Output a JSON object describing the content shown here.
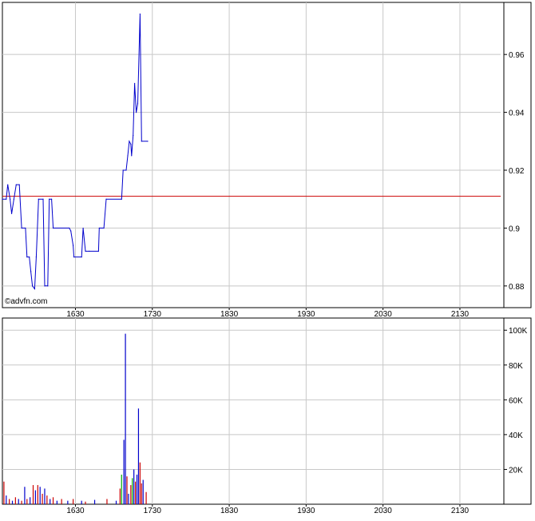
{
  "watermark": "©advfn.com",
  "colors": {
    "price_line": "#0000cc",
    "reference_line": "#cc0000",
    "grid": "#c8c8c8",
    "frame": "#000000",
    "volume_up": "#0000cc",
    "volume_down": "#cc0000",
    "volume_neutral": "#00aa00"
  },
  "chart_data": [
    {
      "type": "line",
      "grid": true,
      "x_ticks": [
        "1630",
        "1730",
        "1830",
        "1930",
        "2030",
        "2130"
      ],
      "x_tick_values": [
        1630,
        1730,
        1830,
        1930,
        2030,
        2130
      ],
      "xlim": [
        1535,
        2183
      ],
      "y_ticks": [
        "0.96",
        "0.94",
        "0.92",
        "0.9",
        "0.88"
      ],
      "y_tick_values": [
        0.96,
        0.94,
        0.92,
        0.9,
        0.88
      ],
      "ylim": [
        0.8725,
        0.978
      ],
      "reference_line": 0.911,
      "series": [
        {
          "points": [
            [
              1535,
              0.91
            ],
            [
              1540,
              0.91
            ],
            [
              1542,
              0.915
            ],
            [
              1545,
              0.91
            ],
            [
              1547,
              0.905
            ],
            [
              1550,
              0.91
            ],
            [
              1553,
              0.915
            ],
            [
              1557,
              0.915
            ],
            [
              1560,
              0.9
            ],
            [
              1565,
              0.9
            ],
            [
              1567,
              0.89
            ],
            [
              1570,
              0.89
            ],
            [
              1572,
              0.885
            ],
            [
              1574,
              0.88
            ],
            [
              1577,
              0.879
            ],
            [
              1579,
              0.89
            ],
            [
              1582,
              0.91
            ],
            [
              1588,
              0.91
            ],
            [
              1590,
              0.88
            ],
            [
              1594,
              0.88
            ],
            [
              1596,
              0.91
            ],
            [
              1599,
              0.91
            ],
            [
              1601,
              0.9
            ],
            [
              1622,
              0.9
            ],
            [
              1624,
              0.899
            ],
            [
              1627,
              0.894
            ],
            [
              1628,
              0.89
            ],
            [
              1638,
              0.89
            ],
            [
              1640,
              0.9
            ],
            [
              1643,
              0.892
            ],
            [
              1648,
              0.892
            ],
            [
              1660,
              0.892
            ],
            [
              1661,
              0.9
            ],
            [
              1667,
              0.9
            ],
            [
              1670,
              0.91
            ],
            [
              1690,
              0.91
            ],
            [
              1692,
              0.92
            ],
            [
              1696,
              0.92
            ],
            [
              1698,
              0.925
            ],
            [
              1700,
              0.93
            ],
            [
              1702,
              0.929
            ],
            [
              1703,
              0.925
            ],
            [
              1705,
              0.932
            ],
            [
              1707,
              0.95
            ],
            [
              1709,
              0.94
            ],
            [
              1711,
              0.943
            ],
            [
              1714,
              0.974
            ],
            [
              1716,
              0.93
            ],
            [
              1724,
              0.93
            ]
          ]
        }
      ]
    },
    {
      "type": "bar",
      "grid": true,
      "x_ticks": [
        "1630",
        "1730",
        "1830",
        "1930",
        "2030",
        "2130"
      ],
      "x_tick_values": [
        1630,
        1730,
        1830,
        1930,
        2030,
        2130
      ],
      "xlim": [
        1535,
        2183
      ],
      "y_ticks": [
        "100K",
        "80K",
        "60K",
        "40K",
        "20K"
      ],
      "y_tick_values": [
        100000,
        80000,
        60000,
        40000,
        20000
      ],
      "ylim": [
        0,
        107000
      ],
      "bars": [
        {
          "x": 1537,
          "v": 13000,
          "c": "down"
        },
        {
          "x": 1540,
          "v": 5000,
          "c": "up"
        },
        {
          "x": 1544,
          "v": 3000,
          "c": "down"
        },
        {
          "x": 1548,
          "v": 2000,
          "c": "up"
        },
        {
          "x": 1552,
          "v": 4000,
          "c": "down"
        },
        {
          "x": 1556,
          "v": 3000,
          "c": "up"
        },
        {
          "x": 1560,
          "v": 2000,
          "c": "down"
        },
        {
          "x": 1564,
          "v": 10000,
          "c": "up"
        },
        {
          "x": 1567,
          "v": 3000,
          "c": "down"
        },
        {
          "x": 1571,
          "v": 4000,
          "c": "up"
        },
        {
          "x": 1575,
          "v": 11000,
          "c": "down"
        },
        {
          "x": 1578,
          "v": 8000,
          "c": "up"
        },
        {
          "x": 1581,
          "v": 11000,
          "c": "down"
        },
        {
          "x": 1584,
          "v": 10000,
          "c": "up"
        },
        {
          "x": 1587,
          "v": 6000,
          "c": "down"
        },
        {
          "x": 1590,
          "v": 9000,
          "c": "up"
        },
        {
          "x": 1593,
          "v": 5000,
          "c": "down"
        },
        {
          "x": 1597,
          "v": 3000,
          "c": "up"
        },
        {
          "x": 1601,
          "v": 4000,
          "c": "down"
        },
        {
          "x": 1606,
          "v": 2000,
          "c": "up"
        },
        {
          "x": 1612,
          "v": 3000,
          "c": "down"
        },
        {
          "x": 1620,
          "v": 2000,
          "c": "up"
        },
        {
          "x": 1627,
          "v": 3000,
          "c": "down"
        },
        {
          "x": 1638,
          "v": 2000,
          "c": "up"
        },
        {
          "x": 1643,
          "v": 1500,
          "c": "down"
        },
        {
          "x": 1655,
          "v": 2500,
          "c": "up"
        },
        {
          "x": 1671,
          "v": 3000,
          "c": "down"
        },
        {
          "x": 1683,
          "v": 2000,
          "c": "up"
        },
        {
          "x": 1688,
          "v": 9000,
          "c": "down"
        },
        {
          "x": 1690,
          "v": 17000,
          "c": "neutral"
        },
        {
          "x": 1693,
          "v": 37000,
          "c": "up"
        },
        {
          "x": 1695,
          "v": 98000,
          "c": "up"
        },
        {
          "x": 1697,
          "v": 16000,
          "c": "down"
        },
        {
          "x": 1699,
          "v": 6000,
          "c": "up"
        },
        {
          "x": 1702,
          "v": 11000,
          "c": "down"
        },
        {
          "x": 1704,
          "v": 15000,
          "c": "neutral"
        },
        {
          "x": 1706,
          "v": 20000,
          "c": "up"
        },
        {
          "x": 1708,
          "v": 13000,
          "c": "down"
        },
        {
          "x": 1710,
          "v": 17000,
          "c": "up"
        },
        {
          "x": 1712,
          "v": 55000,
          "c": "up"
        },
        {
          "x": 1714,
          "v": 24000,
          "c": "down"
        },
        {
          "x": 1716,
          "v": 12000,
          "c": "down"
        },
        {
          "x": 1718,
          "v": 14000,
          "c": "up"
        },
        {
          "x": 1722,
          "v": 7000,
          "c": "down"
        }
      ]
    }
  ]
}
